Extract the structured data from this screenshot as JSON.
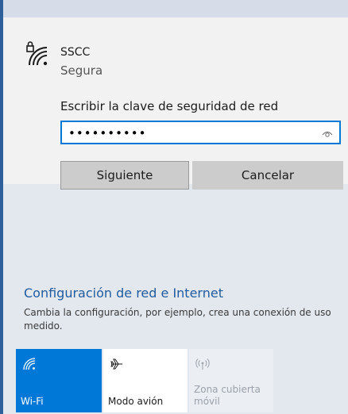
{
  "network": {
    "ssid": "SSCC",
    "status": "Segura",
    "icon": "wifi-secure-icon"
  },
  "password_prompt": {
    "label": "Escribir la clave de seguridad de red",
    "value": "••••••••••",
    "reveal_icon": "eye-icon"
  },
  "buttons": {
    "next": "Siguiente",
    "cancel": "Cancelar"
  },
  "settings": {
    "link": "Configuración de red e Internet",
    "description": "Cambia la configuración, por ejemplo, crea una conexión de uso medido."
  },
  "quick_actions": [
    {
      "label": "Wi-Fi",
      "icon": "wifi-icon",
      "state": "on"
    },
    {
      "label": "Modo avión",
      "icon": "airplane-icon",
      "state": "off"
    },
    {
      "label": "Zona cubierta móvil",
      "icon": "hotspot-icon",
      "state": "disabled"
    }
  ],
  "colors": {
    "accent": "#0078d7",
    "link": "#1f5b9e",
    "panel": "#e3e8ef",
    "card": "#f2f2f2",
    "button": "#cccccc"
  }
}
